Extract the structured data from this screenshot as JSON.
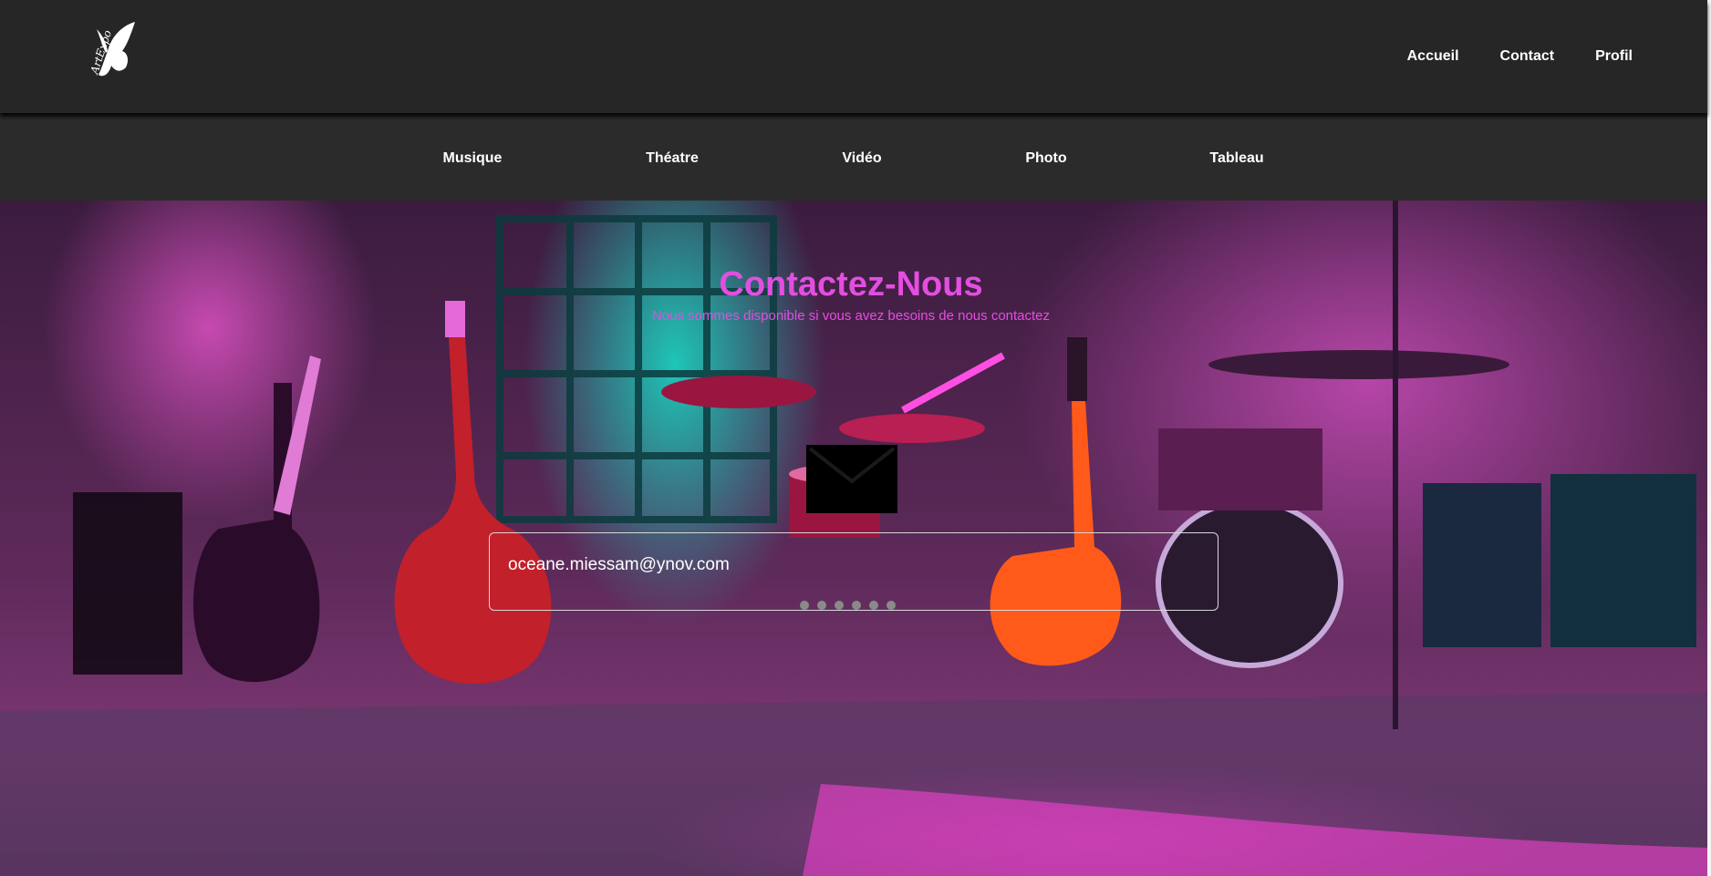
{
  "header": {
    "logo_icon": "butterfly-logo-icon",
    "logo_text": "ArtExpo",
    "nav": [
      {
        "label": "Accueil"
      },
      {
        "label": "Contact"
      },
      {
        "label": "Profil"
      }
    ]
  },
  "categories": [
    {
      "label": "Musique"
    },
    {
      "label": "Théatre"
    },
    {
      "label": "Vidéo"
    },
    {
      "label": "Photo"
    },
    {
      "label": "Tableau"
    }
  ],
  "hero": {
    "background": "music-stage-guitars-drums-photo",
    "title": "Contactez-Nous",
    "subtitle": "Nous sommes disponible si vous avez besoins de nous contactez",
    "mail_icon": "envelope-icon",
    "email_value": "oceane.miessam@ynov.com",
    "password_dots": 6
  },
  "colors": {
    "header_bg": "#262626",
    "category_bg": "#2b2b2b",
    "accent": "#e34ee1"
  }
}
